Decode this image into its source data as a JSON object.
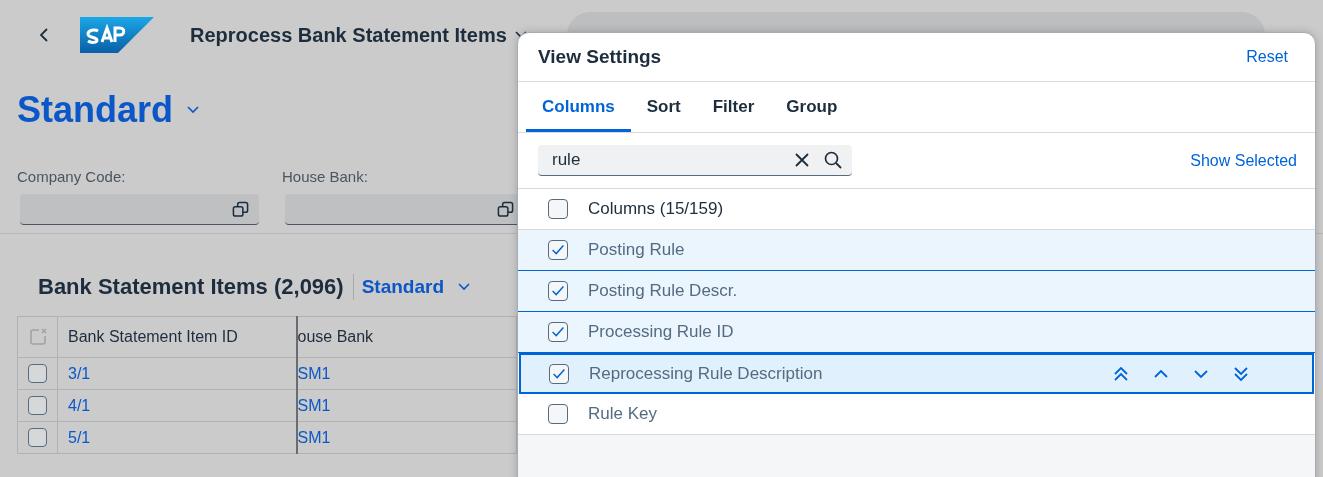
{
  "header": {
    "title": "Reprocess Bank Statement Items"
  },
  "variant": {
    "title": "Standard"
  },
  "filters": [
    {
      "label": "Company Code:"
    },
    {
      "label": "House Bank:"
    }
  ],
  "table": {
    "title": "Bank Statement Items (2,096)",
    "variant": "Standard",
    "columns": [
      "Bank Statement Item ID",
      "ouse Bank"
    ],
    "rows": [
      {
        "selected": false,
        "cells": [
          "3/1",
          "SM1"
        ]
      },
      {
        "selected": false,
        "cells": [
          "4/1",
          "SM1"
        ]
      },
      {
        "selected": false,
        "cells": [
          "5/1",
          "SM1"
        ]
      }
    ]
  },
  "dialog": {
    "title": "View Settings",
    "reset": "Reset",
    "tabs": [
      {
        "label": "Columns",
        "selected": true
      },
      {
        "label": "Sort",
        "selected": false
      },
      {
        "label": "Filter",
        "selected": false
      },
      {
        "label": "Group",
        "selected": false
      }
    ],
    "search": {
      "value": "rule"
    },
    "show_selected": "Show Selected",
    "header_row": {
      "label": "Columns (15/159)",
      "checked": false
    },
    "items": [
      {
        "label": "Posting Rule",
        "checked": true,
        "focused": false
      },
      {
        "label": "Posting Rule Descr.",
        "checked": true,
        "focused": false
      },
      {
        "label": "Processing Rule ID",
        "checked": true,
        "focused": false
      },
      {
        "label": "Reprocessing Rule Description",
        "checked": true,
        "focused": true
      },
      {
        "label": "Rule Key",
        "checked": false,
        "focused": false
      }
    ]
  }
}
